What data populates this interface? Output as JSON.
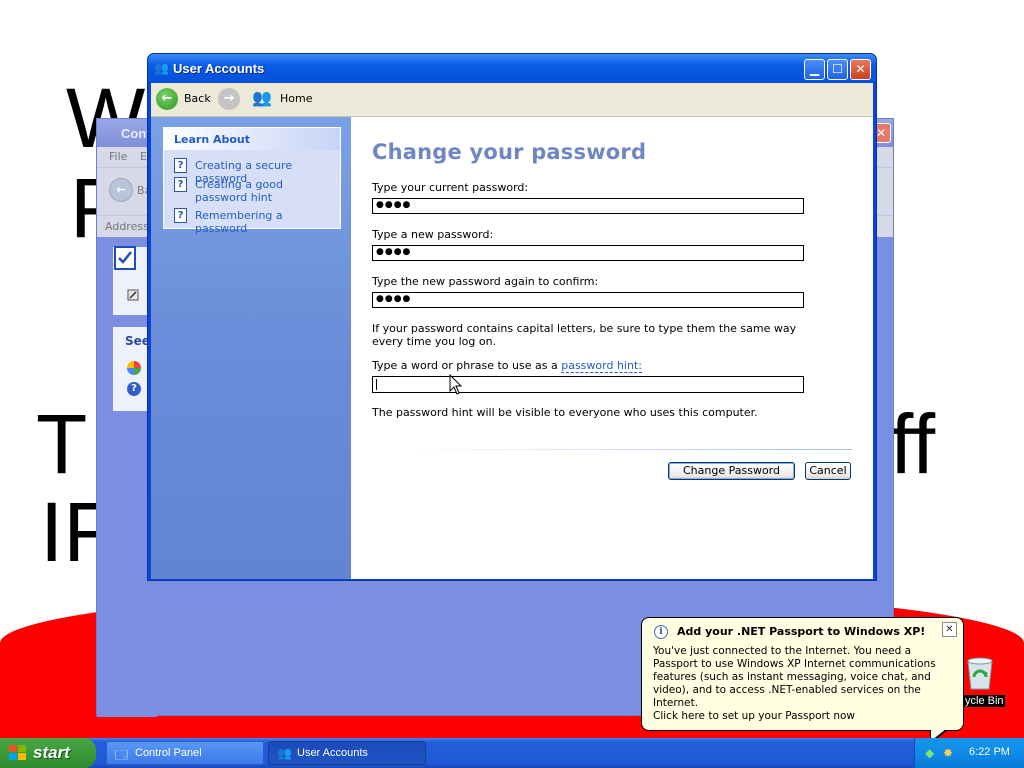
{
  "desktop": {
    "slide_fragments": [
      "W",
      "P",
      "T",
      "ff",
      "IF"
    ],
    "recycle_bin_label": "ycle Bin"
  },
  "control_panel_window": {
    "title": "Cont",
    "menu": [
      "File",
      "E"
    ],
    "back_label": "Ba",
    "address_label": "Address",
    "see_label": "See"
  },
  "user_accounts_window": {
    "title": "User Accounts",
    "toolbar": {
      "back": "Back",
      "home": "Home"
    },
    "sidebar": {
      "heading": "Learn About",
      "links": [
        "Creating a secure password",
        "Creating a good password hint",
        "Remembering a password"
      ]
    },
    "form": {
      "title": "Change your password",
      "current_label": "Type your current password:",
      "current_value": "●●●●",
      "new_label": "Type a new password:",
      "new_value": "●●●●",
      "confirm_label": "Type the new password again to confirm:",
      "confirm_value": "●●●●",
      "caps_note": "If your password contains capital letters, be sure to type them the same way every time you log on.",
      "hint_label_prefix": "Type a word or phrase to use as a ",
      "hint_link": "password hint:",
      "hint_value": "",
      "hint_note": "The password hint will be visible to everyone who uses this computer.",
      "change_button": "Change Password",
      "cancel_button": "Cancel"
    }
  },
  "taskbar": {
    "start_label": "start",
    "tasks": [
      "Control Panel",
      "User Accounts"
    ],
    "active_task": "User Accounts",
    "clock": "6:22 PM"
  },
  "balloon": {
    "title": "Add your .NET Passport to Windows XP!",
    "body": "You've just connected to the Internet.  You need a Passport to use Windows XP Internet communications features (such as instant messaging, voice chat, and video), and to access .NET-enabled services on the Internet.",
    "cta": "Click here to set up your Passport now"
  },
  "colors": {
    "xp_blue_title": "#0a5ce6",
    "start_green": "#3a9a36",
    "link_blue": "#215dc6",
    "balloon_bg": "#ffffe1",
    "desktop_red": "#ff0000"
  }
}
